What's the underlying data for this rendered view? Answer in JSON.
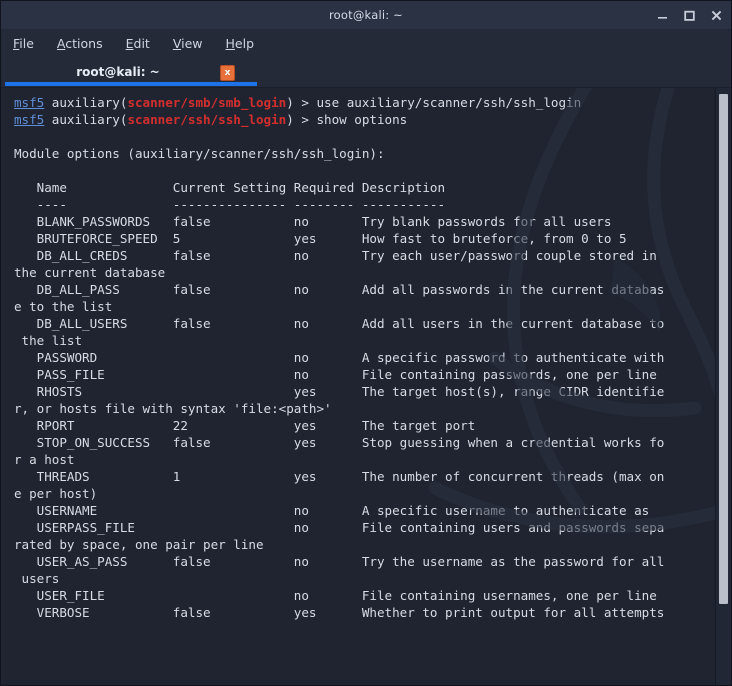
{
  "window": {
    "title": "root@kali: ~",
    "controls": [
      {
        "name": "minimize",
        "glyph": "minimize-icon"
      },
      {
        "name": "maximize",
        "glyph": "maximize-icon"
      },
      {
        "name": "close",
        "glyph": "close-icon"
      }
    ]
  },
  "menubar": {
    "items": [
      {
        "label": "File",
        "mnemonic": "F"
      },
      {
        "label": "Actions",
        "mnemonic": "A"
      },
      {
        "label": "Edit",
        "mnemonic": "E"
      },
      {
        "label": "View",
        "mnemonic": "V"
      },
      {
        "label": "Help",
        "mnemonic": "H"
      }
    ]
  },
  "tabbar": {
    "tabs": [
      {
        "label": "root@kali: ~",
        "active": true,
        "close_glyph": "x"
      }
    ]
  },
  "terminal": {
    "prompts": [
      {
        "shell": "msf5",
        "context_prefix": " auxiliary(",
        "module": "scanner/smb/smb_login",
        "context_suffix": ") > ",
        "command": "use auxiliary/scanner/ssh/ssh_login"
      },
      {
        "shell": "msf5",
        "context_prefix": " auxiliary(",
        "module": "scanner/ssh/ssh_login",
        "context_suffix": ") > ",
        "command": "show options"
      }
    ],
    "module_options_heading": "Module options (auxiliary/scanner/ssh/ssh_login):",
    "table": {
      "headers": [
        "Name",
        "Current Setting",
        "Required",
        "Description"
      ],
      "separators": [
        "----",
        "---------------",
        "--------",
        "-----------"
      ],
      "rows": [
        {
          "name": "BLANK_PASSWORDS",
          "current": "false",
          "required": "no",
          "description": "Try blank passwords for all users"
        },
        {
          "name": "BRUTEFORCE_SPEED",
          "current": "5",
          "required": "yes",
          "description": "How fast to bruteforce, from 0 to 5"
        },
        {
          "name": "DB_ALL_CREDS",
          "current": "false",
          "required": "no",
          "description": "Try each user/password couple stored in the current database"
        },
        {
          "name": "DB_ALL_PASS",
          "current": "false",
          "required": "no",
          "description": "Add all passwords in the current database to the list"
        },
        {
          "name": "DB_ALL_USERS",
          "current": "false",
          "required": "no",
          "description": "Add all users in the current database to the list"
        },
        {
          "name": "PASSWORD",
          "current": "",
          "required": "no",
          "description": "A specific password to authenticate with"
        },
        {
          "name": "PASS_FILE",
          "current": "",
          "required": "no",
          "description": "File containing passwords, one per line"
        },
        {
          "name": "RHOSTS",
          "current": "",
          "required": "yes",
          "description": "The target host(s), range CIDR identifier, or hosts file with syntax 'file:<path>'"
        },
        {
          "name": "RPORT",
          "current": "22",
          "required": "yes",
          "description": "The target port"
        },
        {
          "name": "STOP_ON_SUCCESS",
          "current": "false",
          "required": "yes",
          "description": "Stop guessing when a credential works for a host"
        },
        {
          "name": "THREADS",
          "current": "1",
          "required": "yes",
          "description": "The number of concurrent threads (max one per host)"
        },
        {
          "name": "USERNAME",
          "current": "",
          "required": "no",
          "description": "A specific username to authenticate as"
        },
        {
          "name": "USERPASS_FILE",
          "current": "",
          "required": "no",
          "description": "File containing users and passwords separated by space, one pair per line"
        },
        {
          "name": "USER_AS_PASS",
          "current": "false",
          "required": "no",
          "description": "Try the username as the password for all users"
        },
        {
          "name": "USER_FILE",
          "current": "",
          "required": "no",
          "description": "File containing usernames, one per line"
        },
        {
          "name": "VERBOSE",
          "current": "false",
          "required": "yes",
          "description": "Whether to print output for all attempts"
        }
      ]
    },
    "layout": {
      "columns_per_line": 86,
      "indent": "   ",
      "col_name_width": 18,
      "col_current_width": 16,
      "col_required_width": 9
    }
  },
  "scrollbar": {
    "name": "terminal-scrollbar"
  },
  "colors": {
    "titlebar_bg": "#2b3243",
    "window_bg": "#242a38",
    "terminal_bg": "#1f2430",
    "text": "#d7dbe4",
    "prompt_shell": "#5f8fd8",
    "prompt_module": "#d32e2e",
    "tab_accent": "#1e73e8",
    "tab_close_bg": "#e8703a",
    "scroll_thumb": "#b9bec9"
  }
}
